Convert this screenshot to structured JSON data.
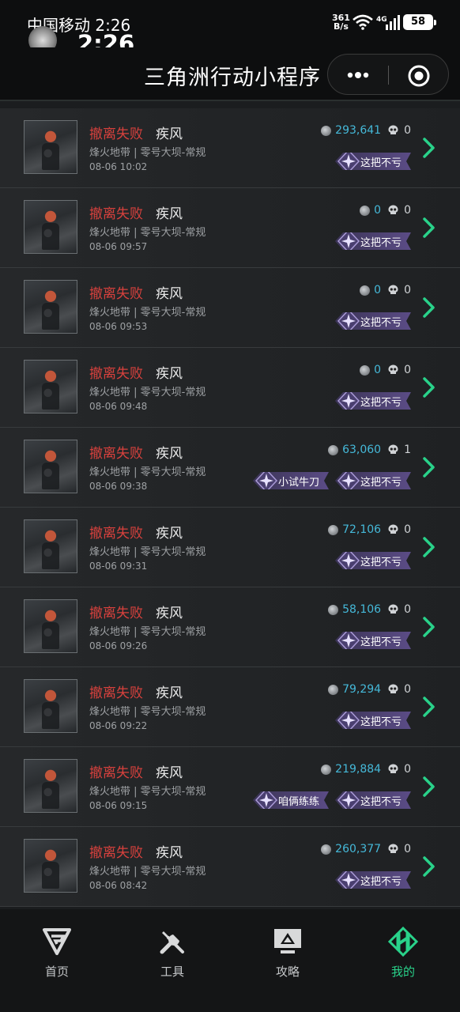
{
  "status_bar": {
    "carrier_time": "中国移动 2:26",
    "clock": "2:26",
    "net_speed_value": "361",
    "net_speed_unit": "B/s",
    "network": "4G",
    "battery": "58"
  },
  "header": {
    "title": "三角洲行动小程序",
    "more_icon": "more-dots-icon",
    "target_icon": "target-icon"
  },
  "records": [
    {
      "status": "撤离失败",
      "mode": "疾风",
      "map": "烽火地带 | 零号大坝-常规",
      "time": "08-06 10:02",
      "value": "293,641",
      "kills": "0",
      "badges": [
        "这把不亏"
      ]
    },
    {
      "status": "撤离失败",
      "mode": "疾风",
      "map": "烽火地带 | 零号大坝-常规",
      "time": "08-06 09:57",
      "value": "0",
      "kills": "0",
      "badges": [
        "这把不亏"
      ]
    },
    {
      "status": "撤离失败",
      "mode": "疾风",
      "map": "烽火地带 | 零号大坝-常规",
      "time": "08-06 09:53",
      "value": "0",
      "kills": "0",
      "badges": [
        "这把不亏"
      ]
    },
    {
      "status": "撤离失败",
      "mode": "疾风",
      "map": "烽火地带 | 零号大坝-常规",
      "time": "08-06 09:48",
      "value": "0",
      "kills": "0",
      "badges": [
        "这把不亏"
      ]
    },
    {
      "status": "撤离失败",
      "mode": "疾风",
      "map": "烽火地带 | 零号大坝-常规",
      "time": "08-06 09:38",
      "value": "63,060",
      "kills": "1",
      "badges": [
        "小试牛刀",
        "这把不亏"
      ]
    },
    {
      "status": "撤离失败",
      "mode": "疾风",
      "map": "烽火地带 | 零号大坝-常规",
      "time": "08-06 09:31",
      "value": "72,106",
      "kills": "0",
      "badges": [
        "这把不亏"
      ]
    },
    {
      "status": "撤离失败",
      "mode": "疾风",
      "map": "烽火地带 | 零号大坝-常规",
      "time": "08-06 09:26",
      "value": "58,106",
      "kills": "0",
      "badges": [
        "这把不亏"
      ]
    },
    {
      "status": "撤离失败",
      "mode": "疾风",
      "map": "烽火地带 | 零号大坝-常规",
      "time": "08-06 09:22",
      "value": "79,294",
      "kills": "0",
      "badges": [
        "这把不亏"
      ]
    },
    {
      "status": "撤离失败",
      "mode": "疾风",
      "map": "烽火地带 | 零号大坝-常规",
      "time": "08-06 09:15",
      "value": "219,884",
      "kills": "0",
      "badges": [
        "咱俩练练",
        "这把不亏"
      ]
    },
    {
      "status": "撤离失败",
      "mode": "疾风",
      "map": "烽火地带 | 零号大坝-常规",
      "time": "08-06 08:42",
      "value": "260,377",
      "kills": "0",
      "badges": [
        "这把不亏"
      ]
    }
  ],
  "colors": {
    "fail_red": "#d8413d",
    "value_blue": "#45b9d9",
    "badge_purple": "#5b4c86",
    "accent_green": "#29d28a"
  },
  "bottom_nav": {
    "tabs": [
      {
        "label": "首页",
        "icon": "home-logo-icon"
      },
      {
        "label": "工具",
        "icon": "tools-icon"
      },
      {
        "label": "攻略",
        "icon": "guide-monitor-icon"
      },
      {
        "label": "我的",
        "icon": "profile-logo-icon"
      }
    ],
    "active_index": 3
  }
}
